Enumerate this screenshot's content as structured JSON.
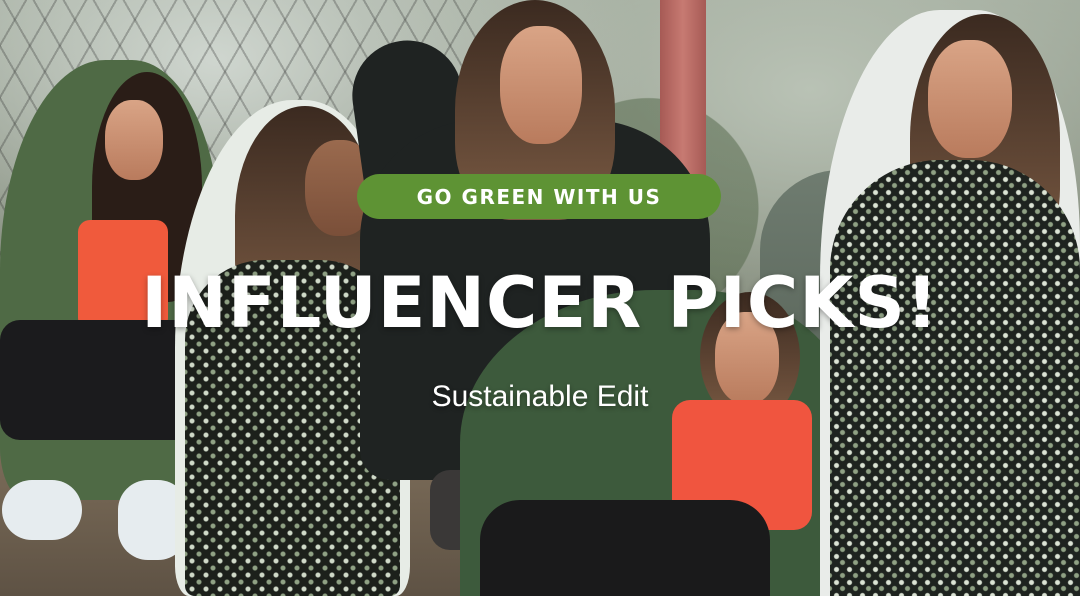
{
  "banner": {
    "badge_label": "GO GREEN WITH US",
    "headline": "INFLUENCER PICKS!",
    "subheadline": "Sustainable Edit",
    "colors": {
      "badge_bg": "#5e9334",
      "text": "#ffffff"
    }
  }
}
